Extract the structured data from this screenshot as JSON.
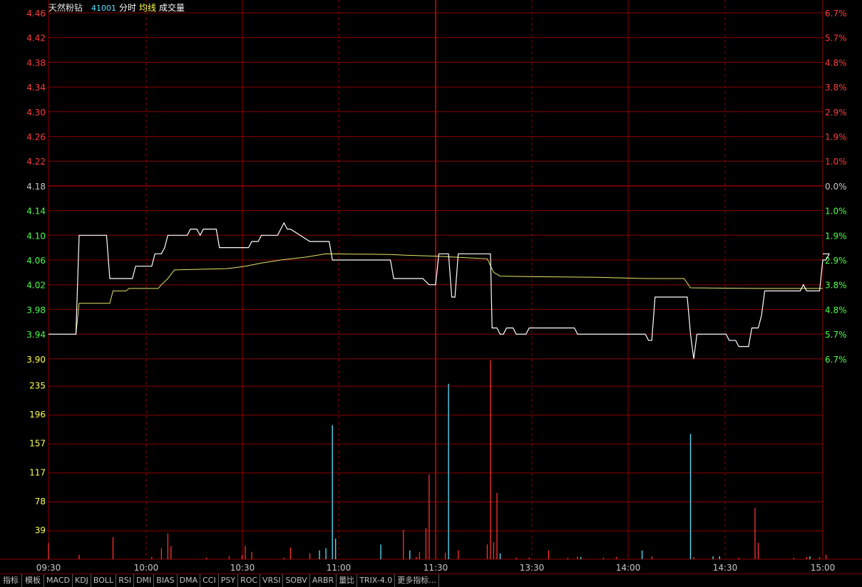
{
  "header": {
    "name": "天然粉钻",
    "code": "41001",
    "label_time": "分时",
    "label_avg": "均线",
    "label_vol": "成交量"
  },
  "colors": {
    "background": "#000000",
    "grid": "#8b0000",
    "price_line": "#ffffff",
    "avg_line": "#e6e66a",
    "up": "#ff3b3b",
    "down": "#49ff49",
    "flat": "#c8c8c8",
    "vol_axis": "#ffff55",
    "vol_up": "#ff3030",
    "vol_down": "#55e6ff",
    "time_text": "#c8c8c8"
  },
  "price_axis": {
    "labels": [
      "4.46",
      "4.42",
      "4.38",
      "4.34",
      "4.30",
      "4.26",
      "4.22",
      "4.18",
      "4.14",
      "4.10",
      "4.06",
      "4.02",
      "3.98",
      "3.94",
      "3.90"
    ],
    "pct_labels": [
      "6.7%",
      "5.7%",
      "4.8%",
      "3.8%",
      "2.9%",
      "1.9%",
      "1.0%",
      "0.0%",
      "1.0%",
      "1.9%",
      "2.9%",
      "3.8%",
      "4.8%",
      "5.7%",
      "6.7%"
    ],
    "prev_close_index": 7
  },
  "volume_axis": {
    "labels": [
      "235",
      "196",
      "157",
      "117",
      "78",
      "39"
    ]
  },
  "time_axis": {
    "labels": [
      "09:30",
      "10:00",
      "10:30",
      "11:00",
      "11:30",
      "13:30",
      "14:00",
      "14:30",
      "15:00"
    ]
  },
  "chart_data": {
    "type": "line",
    "title": "天然粉钻 41001 分时",
    "x_domain_minutes": [
      0,
      240
    ],
    "y_range": [
      3.9,
      4.46
    ],
    "prev_close": 4.18,
    "series": [
      {
        "name": "分时",
        "points": [
          [
            0,
            3.94
          ],
          [
            8.5,
            3.94
          ],
          [
            9.5,
            4.1
          ],
          [
            18,
            4.1
          ],
          [
            19,
            4.03
          ],
          [
            26,
            4.03
          ],
          [
            27,
            4.05
          ],
          [
            32,
            4.05
          ],
          [
            33,
            4.07
          ],
          [
            35,
            4.07
          ],
          [
            36,
            4.08
          ],
          [
            37,
            4.1
          ],
          [
            43,
            4.1
          ],
          [
            44,
            4.11
          ],
          [
            46,
            4.11
          ],
          [
            47,
            4.1
          ],
          [
            48,
            4.11
          ],
          [
            50,
            4.11
          ],
          [
            52,
            4.11
          ],
          [
            53,
            4.08
          ],
          [
            60,
            4.08
          ],
          [
            62,
            4.08
          ],
          [
            63,
            4.09
          ],
          [
            65,
            4.09
          ],
          [
            66,
            4.1
          ],
          [
            71,
            4.1
          ],
          [
            72,
            4.11
          ],
          [
            73,
            4.12
          ],
          [
            74,
            4.11
          ],
          [
            75,
            4.11
          ],
          [
            78,
            4.1
          ],
          [
            81,
            4.09
          ],
          [
            87,
            4.09
          ],
          [
            88,
            4.06
          ],
          [
            104,
            4.06
          ],
          [
            106,
            4.06
          ],
          [
            107,
            4.03
          ],
          [
            116,
            4.03
          ],
          [
            118,
            4.02
          ],
          [
            120,
            4.02
          ],
          [
            121,
            4.07
          ],
          [
            124,
            4.07
          ],
          [
            125,
            4.0
          ],
          [
            126,
            4.0
          ],
          [
            127,
            4.07
          ],
          [
            136,
            4.07
          ],
          [
            137,
            4.07
          ],
          [
            137.5,
            3.95
          ],
          [
            139,
            3.95
          ],
          [
            140,
            3.94
          ],
          [
            141,
            3.94
          ],
          [
            142,
            3.95
          ],
          [
            144,
            3.95
          ],
          [
            145,
            3.94
          ],
          [
            148,
            3.94
          ],
          [
            149,
            3.95
          ],
          [
            163,
            3.95
          ],
          [
            164,
            3.94
          ],
          [
            180,
            3.94
          ],
          [
            185,
            3.94
          ],
          [
            186,
            3.93
          ],
          [
            187,
            3.93
          ],
          [
            188,
            4.0
          ],
          [
            198,
            4.0
          ],
          [
            199,
            3.94
          ],
          [
            200,
            3.9
          ],
          [
            201,
            3.94
          ],
          [
            210,
            3.94
          ],
          [
            211,
            3.93
          ],
          [
            213,
            3.93
          ],
          [
            214,
            3.92
          ],
          [
            217,
            3.92
          ],
          [
            218,
            3.95
          ],
          [
            220,
            3.95
          ],
          [
            221,
            3.97
          ],
          [
            222,
            4.01
          ],
          [
            233,
            4.01
          ],
          [
            234,
            4.02
          ],
          [
            235,
            4.01
          ],
          [
            239,
            4.01
          ],
          [
            240,
            4.06
          ],
          [
            241,
            4.06
          ],
          [
            242,
            4.07
          ],
          [
            240,
            4.07
          ]
        ]
      },
      {
        "name": "均线",
        "points": [
          [
            8.5,
            3.94
          ],
          [
            9.5,
            3.99
          ],
          [
            19,
            3.99
          ],
          [
            20,
            4.01
          ],
          [
            24,
            4.01
          ],
          [
            25,
            4.014
          ],
          [
            34,
            4.014
          ],
          [
            35,
            4.02
          ],
          [
            37,
            4.03
          ],
          [
            39,
            4.044
          ],
          [
            55,
            4.046
          ],
          [
            57,
            4.047
          ],
          [
            61,
            4.05
          ],
          [
            66,
            4.055
          ],
          [
            72,
            4.06
          ],
          [
            80,
            4.065
          ],
          [
            86,
            4.07
          ],
          [
            106,
            4.069
          ],
          [
            110,
            4.068
          ],
          [
            121,
            4.066
          ],
          [
            136,
            4.062
          ],
          [
            138,
            4.04
          ],
          [
            140,
            4.034
          ],
          [
            150,
            4.033
          ],
          [
            170,
            4.032
          ],
          [
            185,
            4.03
          ],
          [
            197,
            4.03
          ],
          [
            199,
            4.015
          ],
          [
            220,
            4.014
          ],
          [
            240,
            4.014
          ]
        ]
      }
    ],
    "volume": {
      "y_range": [
        0,
        274
      ],
      "bars": [
        [
          0,
          22,
          "up"
        ],
        [
          9.5,
          6,
          "up"
        ],
        [
          20,
          30,
          "up"
        ],
        [
          32,
          3,
          "up"
        ],
        [
          35,
          15,
          "up"
        ],
        [
          37,
          35,
          "up"
        ],
        [
          38,
          18,
          "up"
        ],
        [
          49,
          2,
          "up"
        ],
        [
          56,
          4,
          "up"
        ],
        [
          60,
          6,
          "up"
        ],
        [
          61,
          18,
          "up"
        ],
        [
          63,
          10,
          "up"
        ],
        [
          73,
          2,
          "up"
        ],
        [
          75,
          16,
          "up"
        ],
        [
          81,
          8,
          "up"
        ],
        [
          84,
          12,
          "down"
        ],
        [
          86,
          15,
          "down"
        ],
        [
          88,
          182,
          "down"
        ],
        [
          89,
          28,
          "down"
        ],
        [
          103,
          20,
          "down"
        ],
        [
          110,
          40,
          "up"
        ],
        [
          112,
          12,
          "down"
        ],
        [
          114,
          3,
          "up"
        ],
        [
          115,
          10,
          "up"
        ],
        [
          117,
          42,
          "up"
        ],
        [
          118,
          115,
          "up"
        ],
        [
          123,
          9,
          "up"
        ],
        [
          124,
          238,
          "down"
        ],
        [
          127,
          12,
          "up"
        ],
        [
          136,
          20,
          "up"
        ],
        [
          137,
          270,
          "up"
        ],
        [
          138,
          23,
          "up"
        ],
        [
          139,
          90,
          "up"
        ],
        [
          140,
          8,
          "down"
        ],
        [
          145,
          2,
          "up"
        ],
        [
          149,
          2,
          "up"
        ],
        [
          155,
          12,
          "up"
        ],
        [
          161,
          2,
          "up"
        ],
        [
          164,
          4,
          "up"
        ],
        [
          165,
          3,
          "down"
        ],
        [
          172,
          2,
          "up"
        ],
        [
          176,
          3,
          "up"
        ],
        [
          184,
          12,
          "down"
        ],
        [
          187,
          4,
          "up"
        ],
        [
          199,
          170,
          "down"
        ],
        [
          200,
          3,
          "up"
        ],
        [
          206,
          4,
          "down"
        ],
        [
          208,
          4,
          "down"
        ],
        [
          214,
          2,
          "up"
        ],
        [
          219,
          70,
          "up"
        ],
        [
          220,
          22,
          "up"
        ],
        [
          231,
          2,
          "up"
        ],
        [
          235,
          3,
          "up"
        ],
        [
          236,
          4,
          "down"
        ],
        [
          239,
          3,
          "up"
        ],
        [
          241,
          6,
          "up"
        ]
      ]
    }
  },
  "tabs": [
    "指标",
    "模板",
    "MACD",
    "KDJ",
    "BOLL",
    "RSI",
    "DMI",
    "BIAS",
    "DMA",
    "CCI",
    "PSY",
    "ROC",
    "VRSI",
    "SOBV",
    "ARBR",
    "量比",
    "TRIX-4.0",
    "更多指标..."
  ]
}
